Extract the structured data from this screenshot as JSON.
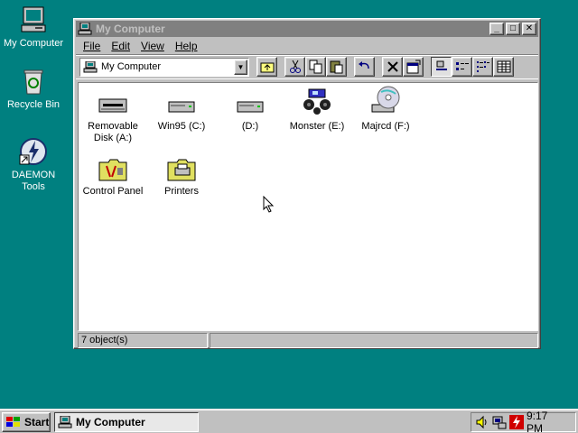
{
  "desktop": {
    "icons": [
      {
        "label": "My Computer",
        "icon": "my-computer-icon"
      },
      {
        "label": "Recycle Bin",
        "icon": "recycle-bin-icon"
      },
      {
        "label": "DAEMON Tools",
        "icon": "daemon-tools-icon"
      }
    ]
  },
  "window": {
    "title": "My Computer",
    "controls": {
      "minimize": "_",
      "maximize": "□",
      "close": "✕"
    },
    "menu": [
      "File",
      "Edit",
      "View",
      "Help"
    ],
    "address": {
      "value": "My Computer"
    },
    "toolbar_buttons": [
      "up-one-level",
      "cut",
      "copy",
      "paste",
      "undo",
      "delete",
      "properties",
      "large-icons",
      "small-icons",
      "list",
      "details"
    ],
    "items": [
      {
        "label": "Removable Disk (A:)",
        "icon": "floppy-drive-icon"
      },
      {
        "label": "Win95 (C:)",
        "icon": "hard-drive-icon"
      },
      {
        "label": "(D:)",
        "icon": "hard-drive-icon"
      },
      {
        "label": "Monster (E:)",
        "icon": "monster-truck-icon"
      },
      {
        "label": "Majrcd (F:)",
        "icon": "cd-drive-icon"
      },
      {
        "label": "Control Panel",
        "icon": "control-panel-folder-icon"
      },
      {
        "label": "Printers",
        "icon": "printers-folder-icon"
      }
    ],
    "status": {
      "objects": "7 object(s)",
      "detail": ""
    }
  },
  "taskbar": {
    "start_label": "Start",
    "tasks": [
      {
        "label": "My Computer"
      }
    ],
    "clock": "9:17 PM"
  },
  "colors": {
    "desktop": "#008080",
    "face": "#c0c0c0",
    "inactive_title": "#808080"
  }
}
